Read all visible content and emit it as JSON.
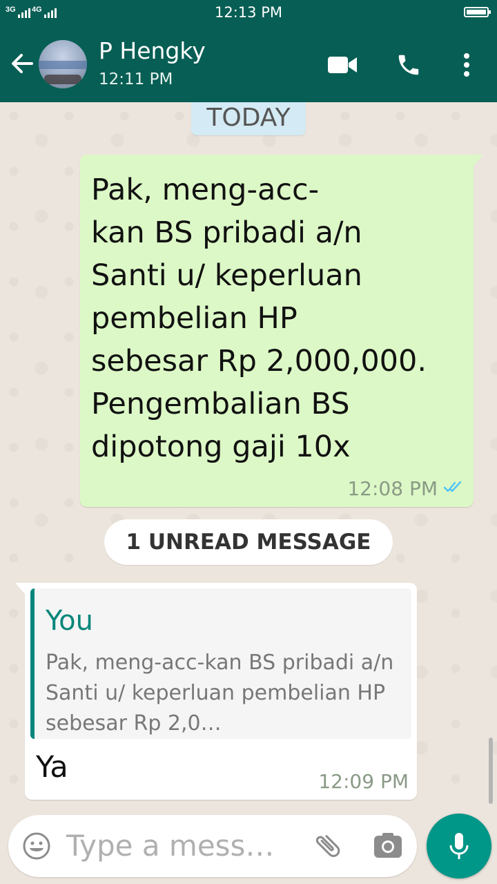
{
  "status_bar": {
    "time": "12:13 PM",
    "network_1": "3G",
    "network_2": "4G",
    "icons": [
      "signal-icon",
      "signal-icon",
      "battery-icon"
    ]
  },
  "header": {
    "contact_name": "P Hengky",
    "last_seen": "12:11 PM",
    "icons": [
      "back-arrow-icon",
      "avatar",
      "video-call-icon",
      "phone-call-icon",
      "more-vert-icon"
    ]
  },
  "chat": {
    "date_label": "TODAY",
    "outgoing": {
      "text": "Pak,  meng-acc-\nkan BS pribadi a/n\nSanti u/ keperluan\npembelian HP\nsebesar Rp 2,000,000.\nPengembalian BS\ndipotong gaji 10x",
      "time": "12:08 PM",
      "status_icon": "double-check-icon",
      "status_color": "#4fc3f7"
    },
    "unread_banner": "1 UNREAD MESSAGE",
    "incoming": {
      "quote_author": "You",
      "quote_text": "Pak,  meng-acc-kan BS pribadi a/n Santi u/ keperluan pembelian HP sebesar Rp 2,0…",
      "text": "Ya",
      "time": "12:09 PM"
    }
  },
  "composer": {
    "placeholder": "Type a mess…",
    "icons": [
      "emoji-icon",
      "attach-icon",
      "camera-icon",
      "mic-icon"
    ]
  },
  "colors": {
    "header": "#075e54",
    "outgoing_bubble": "#dcf8c6",
    "accent": "#009688",
    "quote_author": "#06867a"
  }
}
